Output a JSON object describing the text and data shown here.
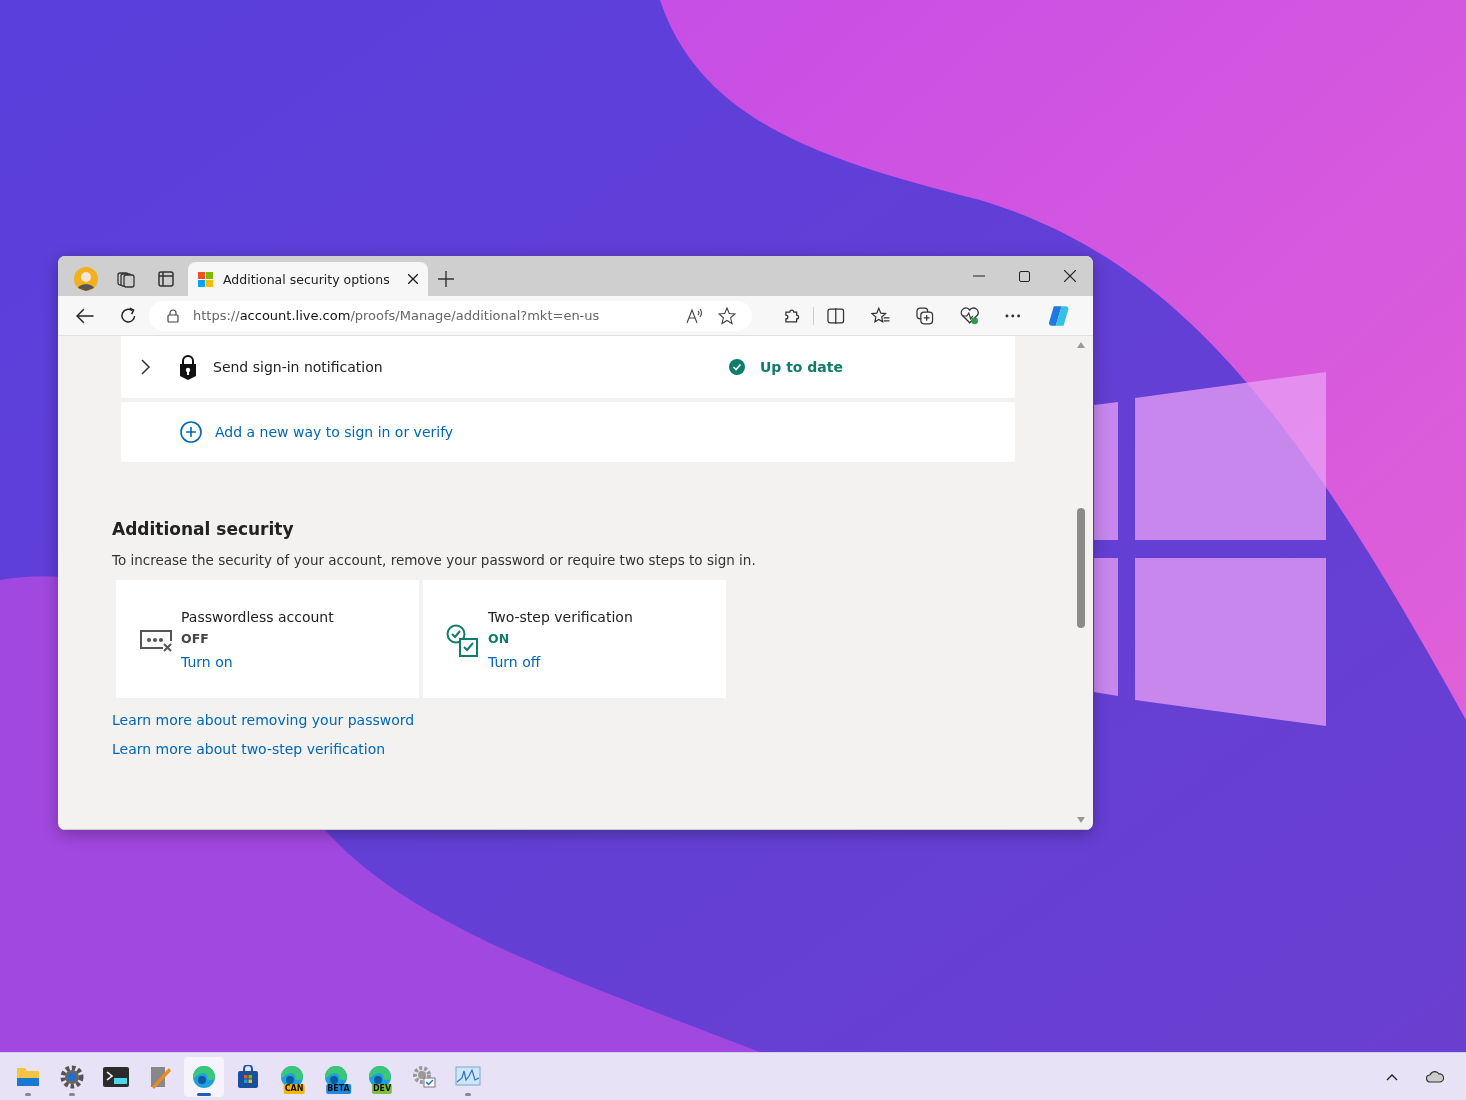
{
  "browser": {
    "tab": {
      "title": "Additional security options",
      "selected": true
    },
    "url": {
      "scheme": "https://",
      "host": "account.live.com",
      "path": "/proofs/Manage/additional?mkt=en-us"
    }
  },
  "methods": [
    {
      "name": "Send sign-in notification",
      "status": "Up to date",
      "expanded": false
    }
  ],
  "add_link": "Add a new way to sign in or verify",
  "section": {
    "title": "Additional security",
    "description": "To increase the security of your account, remove your password or require two steps to sign in."
  },
  "options": [
    {
      "kind": "passwordless",
      "title": "Passwordless account",
      "status": "OFF",
      "on": false,
      "action": "Turn on"
    },
    {
      "kind": "two-step",
      "title": "Two-step verification",
      "status": "ON",
      "on": true,
      "action": "Turn off"
    }
  ],
  "links": [
    "Learn more about removing your password",
    "Learn more about two-step verification"
  ],
  "taskbar": {
    "apps": [
      {
        "kind": "folder",
        "running": true,
        "selected": false
      },
      {
        "kind": "gear",
        "running": true,
        "selected": false
      },
      {
        "kind": "terminal",
        "running": false,
        "selected": false
      },
      {
        "kind": "tools",
        "running": false,
        "selected": false
      },
      {
        "kind": "edge",
        "running": true,
        "selected": true
      },
      {
        "kind": "store",
        "running": false,
        "selected": false
      },
      {
        "kind": "edge",
        "running": false,
        "selected": false,
        "badge": "CAN",
        "color": "#f4b400"
      },
      {
        "kind": "edge",
        "running": false,
        "selected": false,
        "badge": "BETA",
        "color": "#1e88e5"
      },
      {
        "kind": "edge",
        "running": false,
        "selected": false,
        "badge": "DEV",
        "color": "#7cc043"
      },
      {
        "kind": "gear-check",
        "running": false,
        "selected": false
      },
      {
        "kind": "monitor",
        "running": true,
        "selected": false
      }
    ]
  }
}
